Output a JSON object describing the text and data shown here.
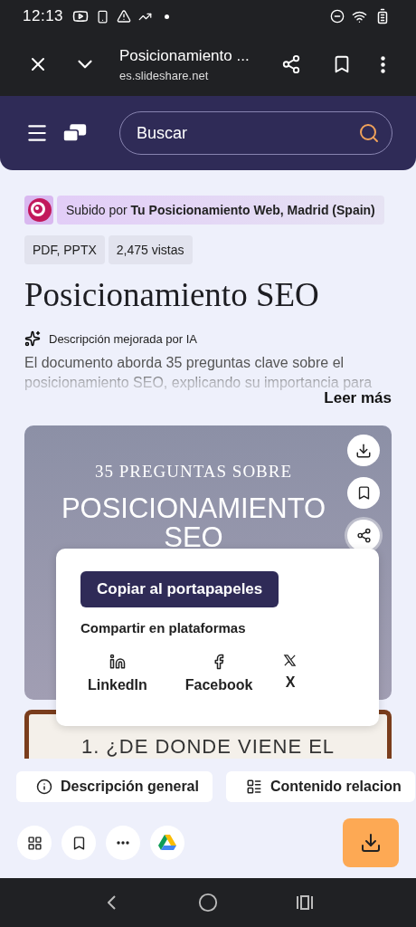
{
  "status_bar": {
    "time": "12:13"
  },
  "browser_bar": {
    "title": "Posicionamiento ...",
    "url": "es.slideshare.net"
  },
  "site_header": {
    "search_placeholder": "Buscar"
  },
  "document": {
    "uploaded_by_label": "Subido por",
    "uploader": "Tu Posicionamiento Web, Madrid (Spain)",
    "tags": [
      "PDF, PPTX",
      "2,475 vistas"
    ],
    "title": "Posicionamiento SEO",
    "ai_label": "Descripción mejorada por IA",
    "description": "El documento aborda 35 preguntas clave sobre el posicionamiento SEO, explicando su importancia para",
    "read_more": "Leer más"
  },
  "slides": [
    {
      "kicker": "35 PREGUNTAS SOBRE",
      "title": "POSICIONAMIENTO SEO"
    },
    {
      "title": "1. ¿DE DONDE VIENE EL"
    }
  ],
  "share_popover": {
    "copy_button": "Copiar al portapapeles",
    "platforms_label": "Compartir en plataformas",
    "platforms": [
      {
        "kind": "linkedin",
        "label": "LinkedIn"
      },
      {
        "kind": "facebook",
        "label": "Facebook"
      },
      {
        "kind": "x",
        "label": "X"
      }
    ]
  },
  "tabs": [
    {
      "kind": "info",
      "label": "Descripción general"
    },
    {
      "kind": "list",
      "label": "Contenido relacion"
    }
  ]
}
